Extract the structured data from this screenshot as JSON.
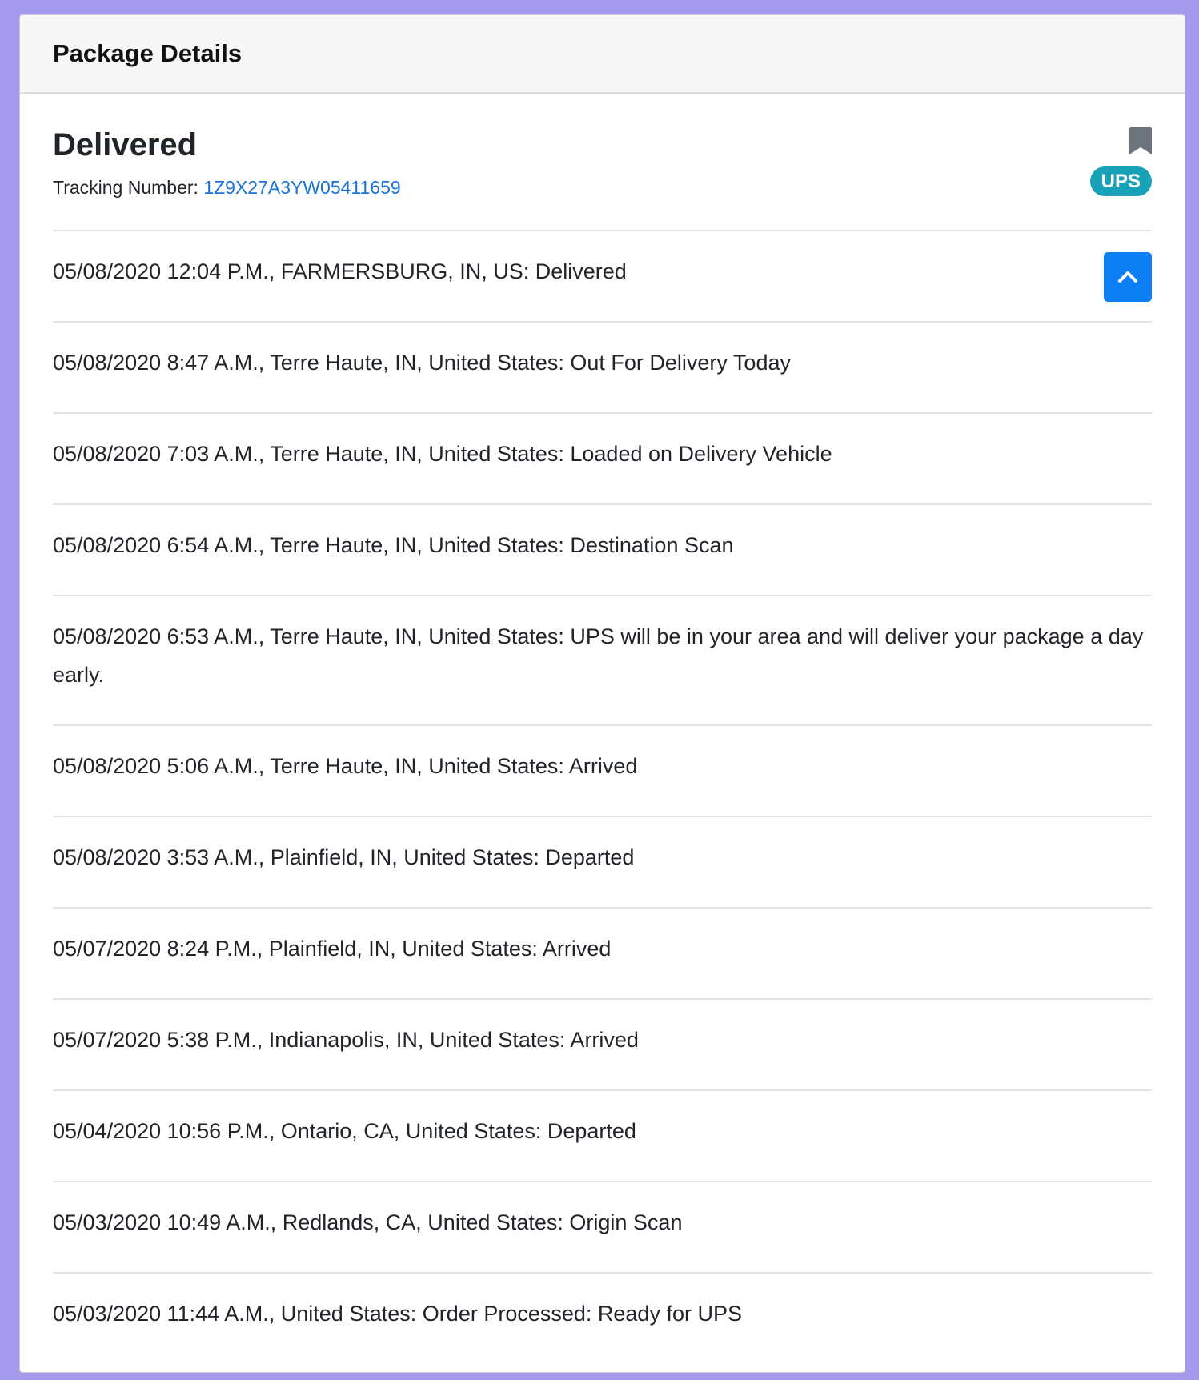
{
  "header": {
    "title": "Package Details"
  },
  "summary": {
    "status": "Delivered",
    "tracking_label": "Tracking Number: ",
    "tracking_number": "1Z9X27A3YW05411659",
    "carrier": "UPS",
    "bookmark_icon": "bookmark-icon",
    "collapse_icon": "chevron-up-icon"
  },
  "events": [
    {
      "text": "05/08/2020 12:04 P.M., FARMERSBURG, IN, US: Delivered"
    },
    {
      "text": "05/08/2020 8:47 A.M., Terre Haute, IN, United States: Out For Delivery Today"
    },
    {
      "text": "05/08/2020 7:03 A.M., Terre Haute, IN, United States: Loaded on Delivery Vehicle"
    },
    {
      "text": "05/08/2020 6:54 A.M., Terre Haute, IN, United States: Destination Scan"
    },
    {
      "text": "05/08/2020 6:53 A.M., Terre Haute, IN, United States: UPS will be in your area and will deliver your package a day early."
    },
    {
      "text": "05/08/2020 5:06 A.M., Terre Haute, IN, United States: Arrived"
    },
    {
      "text": "05/08/2020 3:53 A.M., Plainfield, IN, United States: Departed"
    },
    {
      "text": "05/07/2020 8:24 P.M., Plainfield, IN, United States: Arrived"
    },
    {
      "text": "05/07/2020 5:38 P.M., Indianapolis, IN, United States: Arrived"
    },
    {
      "text": "05/04/2020 10:56 P.M., Ontario, CA, United States: Departed"
    },
    {
      "text": "05/03/2020 10:49 A.M., Redlands, CA, United States: Origin Scan"
    },
    {
      "text": "05/03/2020 11:44 A.M., United States: Order Processed: Ready for UPS"
    }
  ],
  "colors": {
    "page_background": "#a599ec",
    "link": "#1a73d6",
    "badge": "#17a2b8",
    "button": "#0d7ff5"
  }
}
